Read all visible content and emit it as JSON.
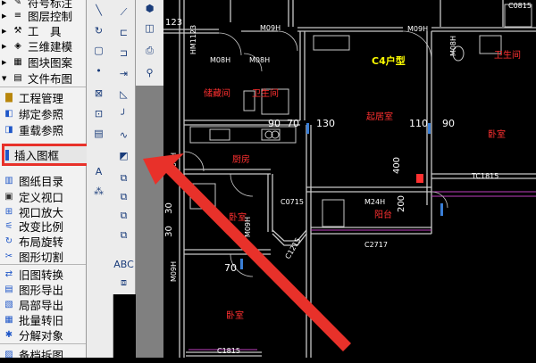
{
  "menu": {
    "items_top": [
      {
        "label": "符号标注",
        "icon": "symbol-icon"
      },
      {
        "label": "图层控制",
        "icon": "layer-icon"
      },
      {
        "label": "工　具",
        "icon": "tools-icon"
      },
      {
        "label": "三维建模",
        "icon": "3d-model-icon"
      },
      {
        "label": "图块图案",
        "icon": "block-icon"
      },
      {
        "label": "文件布图",
        "icon": "file-layout-icon"
      }
    ],
    "items_sub": [
      {
        "label": "工程管理",
        "icon": "project-manage-icon"
      },
      {
        "label": "绑定参照",
        "icon": "bind-xref-icon"
      },
      {
        "label": "重载参照",
        "icon": "reload-xref-icon"
      },
      {
        "label": "插入图框",
        "icon": "insert-frame-icon"
      },
      {
        "label": "图纸目录",
        "icon": "drawing-list-icon"
      },
      {
        "label": "定义视口",
        "icon": "define-viewport-icon"
      },
      {
        "label": "视口放大",
        "icon": "zoom-viewport-icon"
      },
      {
        "label": "改变比例",
        "icon": "change-scale-icon"
      },
      {
        "label": "布局旋转",
        "icon": "layout-rotate-icon"
      },
      {
        "label": "图形切割",
        "icon": "cut-drawing-icon"
      },
      {
        "label": "旧图转换",
        "icon": "convert-old-icon"
      },
      {
        "label": "图形导出",
        "icon": "export-drawing-icon"
      },
      {
        "label": "局部导出",
        "icon": "partial-export-icon"
      },
      {
        "label": "批量转旧",
        "icon": "batch-convert-icon"
      },
      {
        "label": "分解对象",
        "icon": "explode-icon"
      },
      {
        "label": "备档拆图",
        "icon": "split-drawing-icon"
      }
    ],
    "highlighted": "插入图框"
  },
  "drawing": {
    "unit_type": "C4户型",
    "rooms": [
      "储藏间",
      "卫生间",
      "起居室",
      "卧室",
      "厨房",
      "卧室",
      "阳台",
      "卫生间",
      "卧室"
    ],
    "labels": [
      "M09H",
      "M08H",
      "M08H",
      "M09H",
      "M08H",
      "M09H",
      "M09H",
      "M09H",
      "M24H",
      "C0715",
      "C1215",
      "C2717",
      "TC1815",
      "C1815",
      "C0815",
      "HM1123"
    ],
    "dimensions": [
      "130",
      "110",
      "90",
      "70",
      "400",
      "200",
      "70",
      "90",
      "123",
      "30",
      "30"
    ]
  },
  "colors": {
    "room_label": "#ff3030",
    "unit_label": "#ffff00",
    "door_label": "#ffffff",
    "wall": "#c8c8c8",
    "callout": "#e8312a"
  }
}
